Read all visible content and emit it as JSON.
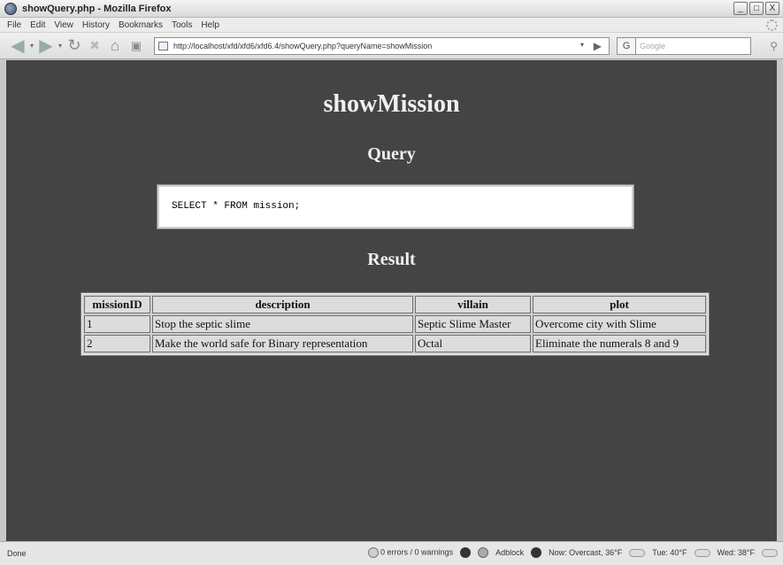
{
  "window": {
    "title": "showQuery.php - Mozilla Firefox",
    "controls": [
      "_",
      "□",
      "X"
    ]
  },
  "menu": [
    "File",
    "Edit",
    "View",
    "History",
    "Bookmarks",
    "Tools",
    "Help"
  ],
  "nav": {
    "url": "http://localhost/xfd/xfd6/xfd6.4/showQuery.php?queryName=showMission",
    "search_engine": "G",
    "search_placeholder": "Google"
  },
  "page": {
    "title": "showMission",
    "query_heading": "Query",
    "query_text": "SELECT * FROM mission;",
    "result_heading": "Result",
    "table": {
      "columns": [
        "missionID",
        "description",
        "villain",
        "plot"
      ],
      "rows": [
        [
          "1",
          "Stop the septic slime",
          "Septic Slime Master",
          "Overcome city with Slime"
        ],
        [
          "2",
          "Make the world safe for Binary representation",
          "Octal",
          "Eliminate the numerals 8 and 9"
        ]
      ]
    }
  },
  "status": {
    "left": "Done",
    "errors": "0 errors / 0 warnings",
    "adblock": "Adblock",
    "weather_now": "Now: Overcast, 36°F",
    "weather_tue": "Tue: 40°F",
    "weather_wed": "Wed: 38°F"
  }
}
